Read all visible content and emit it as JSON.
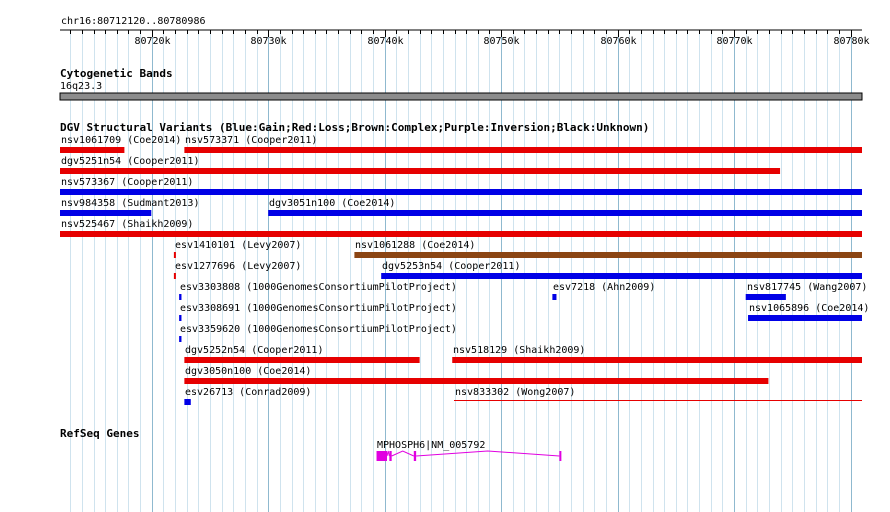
{
  "region": {
    "label": "chr16:80712120..80780986",
    "start": 80712120,
    "end": 80780986
  },
  "ruler": {
    "ticks": [
      {
        "pos": 80720000,
        "label": "80720k"
      },
      {
        "pos": 80730000,
        "label": "80730k"
      },
      {
        "pos": 80740000,
        "label": "80740k"
      },
      {
        "pos": 80750000,
        "label": "80750k"
      },
      {
        "pos": 80760000,
        "label": "80760k"
      },
      {
        "pos": 80770000,
        "label": "80770k"
      },
      {
        "pos": 80780000,
        "label": "80780k"
      }
    ]
  },
  "cytoband": {
    "title": "Cytogenetic Bands",
    "band_label": "16q23.3",
    "color": "#8c8c8c"
  },
  "dgv": {
    "title": "DGV Structural Variants (Blue:Gain;Red:Loss;Brown:Complex;Purple:Inversion;Black:Unknown)",
    "colors": {
      "gain": "#0000e6",
      "loss": "#e60000",
      "complex": "#8b4513"
    },
    "features": [
      {
        "id": "nsv1061709",
        "label": "nsv1061709 (Coe2014)",
        "type": "loss",
        "start": 80712120,
        "end": 80717650,
        "row": 0
      },
      {
        "id": "nsv573371",
        "label": "nsv573371 (Cooper2011)",
        "type": "loss",
        "start": 80722800,
        "end": 80780986,
        "row": 0
      },
      {
        "id": "dgv5251n54",
        "label": "dgv5251n54 (Cooper2011)",
        "type": "loss",
        "start": 80712120,
        "end": 80773950,
        "row": 1
      },
      {
        "id": "nsv573367",
        "label": "nsv573367 (Cooper2011)",
        "type": "gain",
        "start": 80712120,
        "end": 80780986,
        "row": 2
      },
      {
        "id": "nsv984358",
        "label": "nsv984358 (Sudmant2013)",
        "type": "gain",
        "start": 80712120,
        "end": 80719960,
        "row": 3
      },
      {
        "id": "dgv3051n100",
        "label": "dgv3051n100 (Coe2014)",
        "type": "gain",
        "start": 80730000,
        "end": 80780986,
        "row": 3
      },
      {
        "id": "nsv525467",
        "label": "nsv525467 (Shaikh2009)",
        "type": "loss",
        "start": 80712120,
        "end": 80780986,
        "row": 4
      },
      {
        "id": "esv1410101",
        "label": "esv1410101 (Levy2007)",
        "type": "loss",
        "start": 80721900,
        "end": 80722050,
        "row": 5
      },
      {
        "id": "nsv1061288",
        "label": "nsv1061288 (Coe2014)",
        "type": "complex",
        "start": 80737400,
        "end": 80780986,
        "row": 5
      },
      {
        "id": "esv1277696",
        "label": "esv1277696 (Levy2007)",
        "type": "loss",
        "start": 80721900,
        "end": 80722050,
        "row": 6
      },
      {
        "id": "dgv5253n54",
        "label": "dgv5253n54 (Cooper2011)",
        "type": "gain",
        "start": 80739700,
        "end": 80780986,
        "row": 6
      },
      {
        "id": "esv3303808",
        "label": "esv3303808 (1000GenomesConsortiumPilotProject)",
        "type": "gain",
        "start": 80722350,
        "end": 80722550,
        "row": 7
      },
      {
        "id": "esv7218",
        "label": "esv7218 (Ahn2009)",
        "type": "gain",
        "start": 80754400,
        "end": 80754750,
        "row": 7
      },
      {
        "id": "nsv817745",
        "label": "nsv817745 (Wang2007)",
        "type": "gain",
        "start": 80771000,
        "end": 80774450,
        "row": 7
      },
      {
        "id": "esv3308691",
        "label": "esv3308691 (1000GenomesConsortiumPilotProject)",
        "type": "gain",
        "start": 80722350,
        "end": 80722550,
        "row": 8
      },
      {
        "id": "nsv1065896",
        "label": "nsv1065896 (Coe2014)",
        "type": "gain",
        "start": 80771200,
        "end": 80780986,
        "row": 8
      },
      {
        "id": "esv3359620",
        "label": "esv3359620 (1000GenomesConsortiumPilotProject)",
        "type": "gain",
        "start": 80722350,
        "end": 80722550,
        "row": 9
      },
      {
        "id": "dgv5252n54",
        "label": "dgv5252n54 (Cooper2011)",
        "type": "loss",
        "start": 80722800,
        "end": 80743000,
        "row": 10
      },
      {
        "id": "nsv518129",
        "label": "nsv518129 (Shaikh2009)",
        "type": "loss",
        "start": 80745800,
        "end": 80780986,
        "row": 10
      },
      {
        "id": "dgv3050n100",
        "label": "dgv3050n100 (Coe2014)",
        "type": "loss",
        "start": 80722800,
        "end": 80772950,
        "row": 11
      },
      {
        "id": "esv26713",
        "label": "esv26713 (Conrad2009)",
        "type": "gain",
        "start": 80722800,
        "end": 80723350,
        "row": 12
      },
      {
        "id": "nsv833302",
        "label": "nsv833302 (Wong2007)",
        "type": "loss",
        "start": 80745950,
        "end": 80780986,
        "row": 12,
        "thin": true
      }
    ]
  },
  "refseq": {
    "title": "RefSeq Genes",
    "color": "#e100e1",
    "gene": {
      "label": "MPHOSPH6|NM_005792",
      "start": 80739300,
      "end": 80755150,
      "exons": [
        {
          "start": 80739300,
          "end": 80740200,
          "utr": false
        },
        {
          "start": 80740400,
          "end": 80740600,
          "utr": true
        },
        {
          "start": 80742500,
          "end": 80742700,
          "utr": true
        },
        {
          "start": 80755000,
          "end": 80755150,
          "utr": true
        }
      ]
    }
  }
}
